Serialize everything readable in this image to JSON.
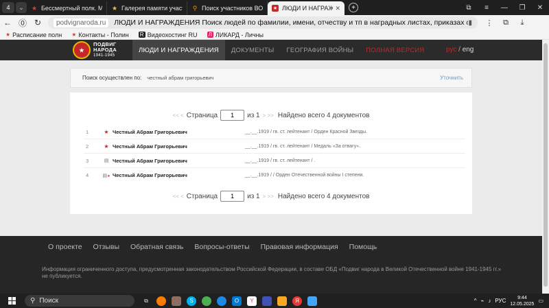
{
  "browser": {
    "tab_count": "4",
    "tabs": [
      {
        "title": "Бессмертный полк. Моск",
        "icon": "star-icon"
      },
      {
        "title": "Галерея памяти участник",
        "icon": "star-icon"
      },
      {
        "title": "Поиск участников ВОВ п",
        "icon": "pin-icon"
      },
      {
        "title": "ЛЮДИ И НАГРАЖДЕН",
        "icon": "site-icon",
        "active": true
      }
    ],
    "domain": "podvignaroda.ru",
    "page_title": "ЛЮДИ И НАГРАЖДЕНИЯ Поиск людей по фамилии, имени, отчеству и тп в наградных листах, приказах о наг...",
    "bookmarks": [
      {
        "label": "Расписание полн"
      },
      {
        "label": "Контакты - Полин"
      },
      {
        "label": "Видеохостинг RU"
      },
      {
        "label": "ЛИКАРД - Личны"
      }
    ]
  },
  "site": {
    "logo": {
      "line1": "ПОДВИГ",
      "line2": "НАРОДА",
      "years": "1941-1945"
    },
    "nav": [
      {
        "label": "ЛЮДИ И НАГРАЖДЕНИЯ"
      },
      {
        "label": "ДОКУМЕНТЫ"
      },
      {
        "label": "ГЕОГРАФИЯ ВОЙНЫ"
      },
      {
        "label": "ПОЛНАЯ ВЕРСИЯ"
      }
    ],
    "lang_ru": "рус",
    "lang_sep": "/",
    "lang_en": "eng"
  },
  "search": {
    "label": "Поиск осуществлен по:",
    "query": "честный абрам григорьевич",
    "refine": "Уточнить"
  },
  "pager": {
    "prev": "<< <",
    "page_label": "Страница",
    "page_value": "1",
    "of_label": "из 1",
    "next": "> >>",
    "total": "Найдено всего 4 документов"
  },
  "results": [
    {
      "num": "1",
      "icon": "star-icon",
      "name": "Честный Абрам Григорьевич",
      "details": "__.__.1919 /  гв. ст. лейтенант /  Орден Красной Звезды."
    },
    {
      "num": "2",
      "icon": "star-icon",
      "name": "Честный Абрам Григорьевич",
      "details": "__.__.1919 /  гв. ст. лейтенант /  Медаль «За отвагу»."
    },
    {
      "num": "3",
      "icon": "document-icon",
      "name": "Честный Абрам Григорьевич",
      "details": "__.__.1919 /  гв. ст. лейтенант /  ."
    },
    {
      "num": "4",
      "icon": "document-star-icon",
      "name": "Честный Абрам Григорьевич",
      "details": "__.__.1919 /   /  Орден Отечественной войны I степени."
    }
  ],
  "footer": {
    "links": [
      {
        "label": "О проекте"
      },
      {
        "label": "Отзывы"
      },
      {
        "label": "Обратная связь"
      },
      {
        "label": "Вопросы-ответы"
      },
      {
        "label": "Правовая информация"
      },
      {
        "label": "Помощь"
      }
    ],
    "note": "Информация ограниченного доступа, предусмотренная законодательством Российской Федерации, в составе ОБД «Подвиг народа в Великой Отечественной войне 1941-1945 гг.» не публикуется."
  },
  "taskbar": {
    "search_placeholder": "Поиск",
    "lang": "РУС",
    "time": "9:44",
    "date": "12.05.2025"
  }
}
